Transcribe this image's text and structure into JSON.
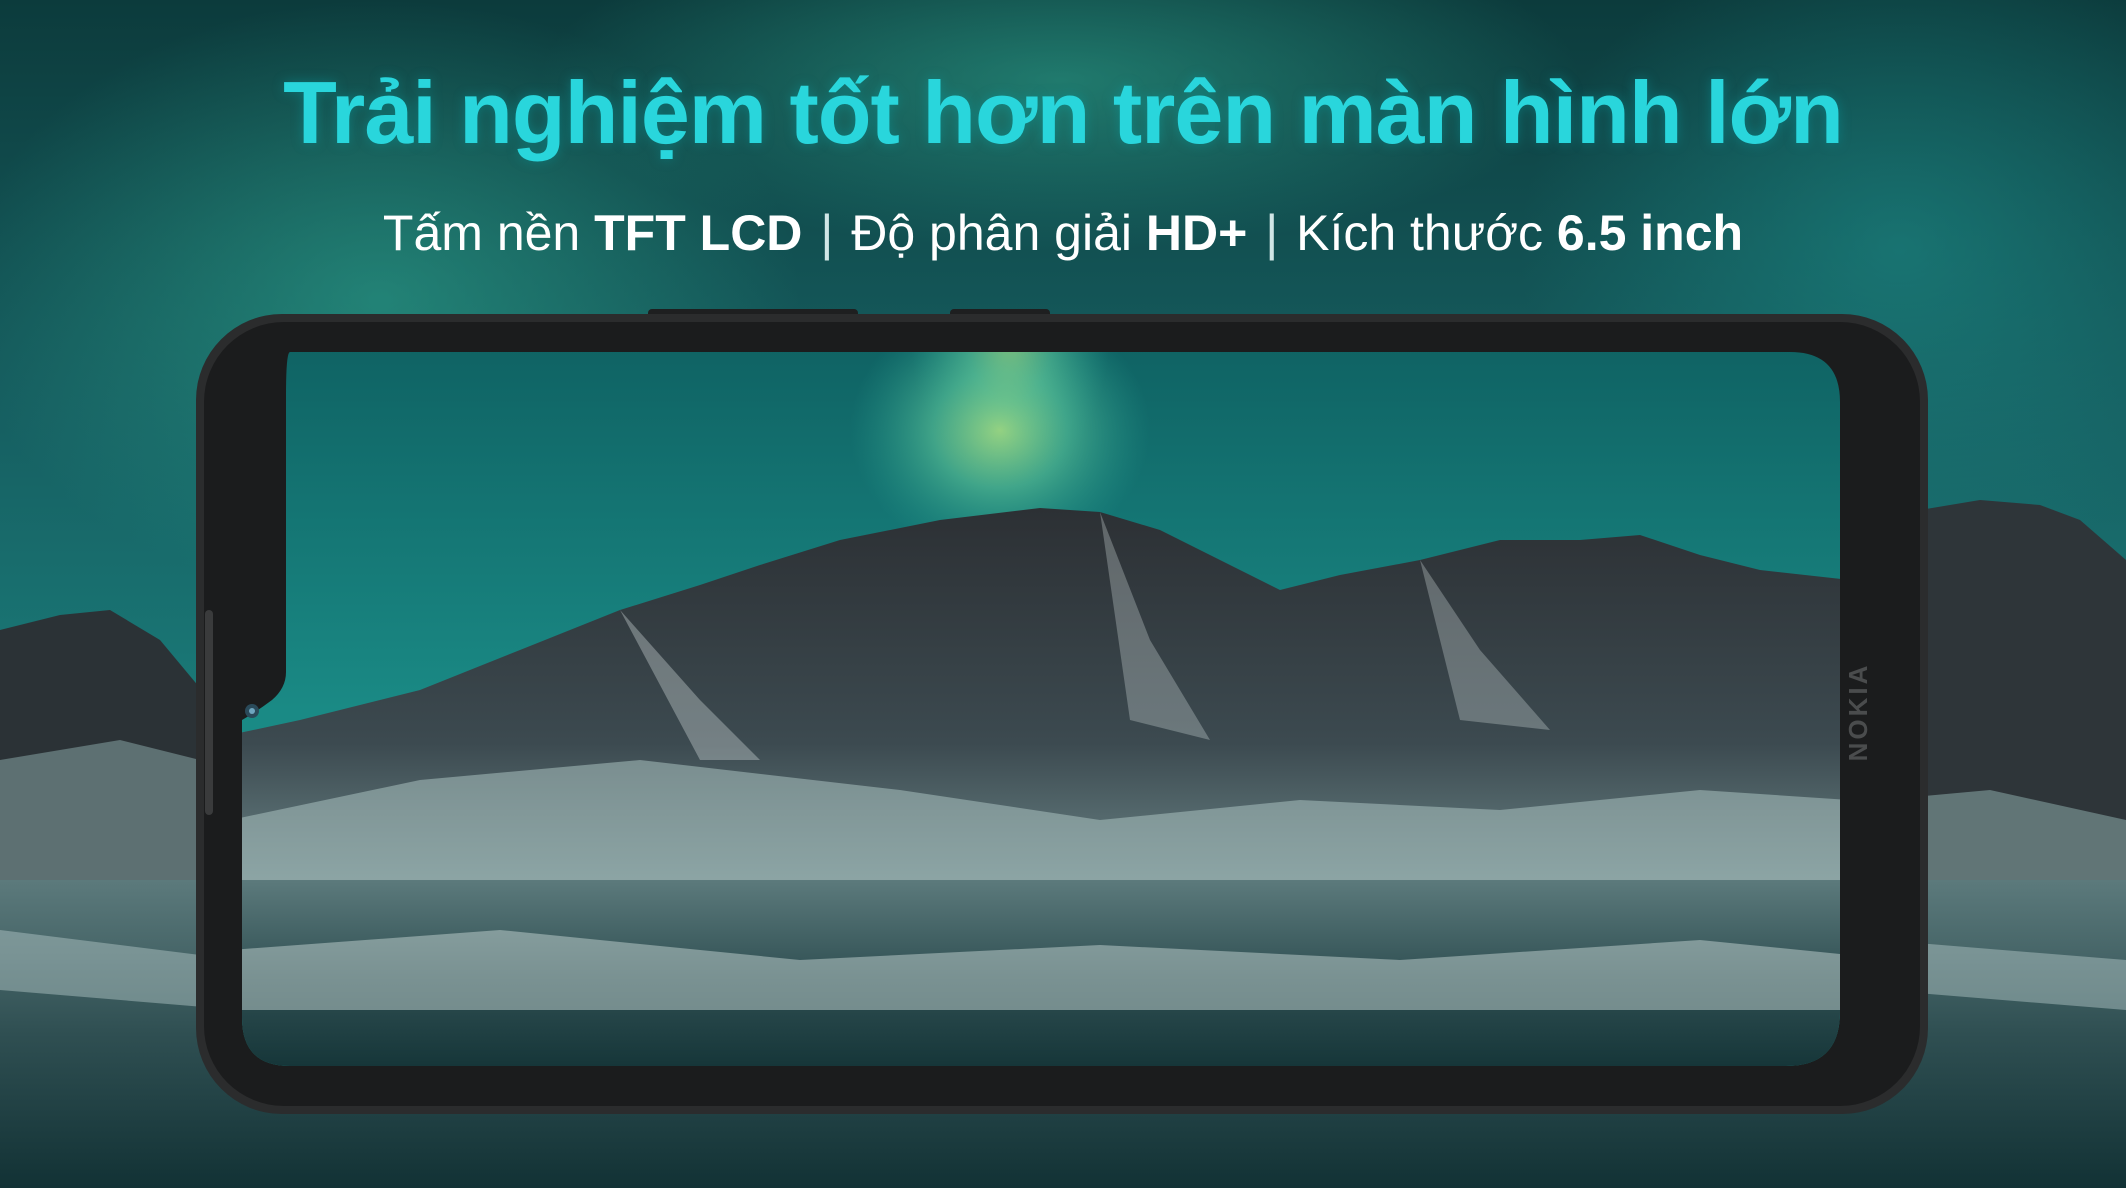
{
  "headline": "Trải nghiệm tốt hơn trên màn hình lớn",
  "subline": {
    "panel_label": "Tấm nền ",
    "panel_value": "TFT LCD",
    "separator": "|",
    "resolution_label": " Độ phân giải ",
    "resolution_value": "HD+",
    "size_label": " Kích thước ",
    "size_value": "6.5 inch"
  },
  "phone": {
    "brand": "NOKIA",
    "frame_color": "#2b2c2d"
  },
  "colors": {
    "headline": "#29d6dc",
    "sky_teal": "#127476",
    "aurora_green": "#7fd39a"
  }
}
